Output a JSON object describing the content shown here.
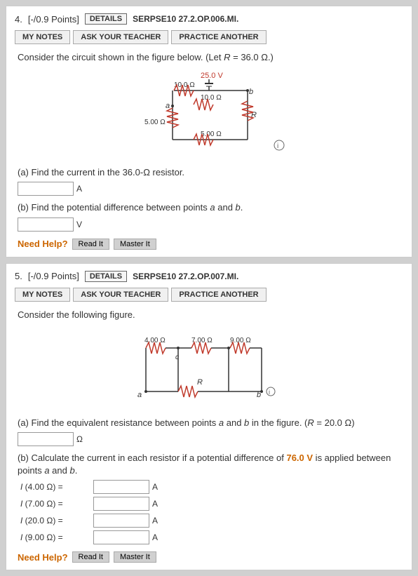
{
  "problems": [
    {
      "number": "4.",
      "points": "[-/0.9 Points]",
      "badge_label": "DETAILS",
      "code": "SERPSE10 27.2.OP.006.MI.",
      "buttons": [
        "MY NOTES",
        "ASK YOUR TEACHER",
        "PRACTICE ANOTHER"
      ],
      "intro": "Consider the circuit shown in the figure below. (Let R = 36.0 Ω.)",
      "sub_a_label": "(a) Find the current in the 36.0-Ω resistor.",
      "sub_a_unit": "A",
      "sub_b_label": "(b) Find the potential difference between points a and b.",
      "sub_b_unit": "V",
      "need_help": "Need Help?",
      "help_btns": [
        "Read It",
        "Master It"
      ]
    },
    {
      "number": "5.",
      "points": "[-/0.9 Points]",
      "badge_label": "DETAILS",
      "code": "SERPSE10 27.2.OP.007.MI.",
      "buttons": [
        "MY NOTES",
        "ASK YOUR TEACHER",
        "PRACTICE ANOTHER"
      ],
      "intro": "Consider the following figure.",
      "sub_a_label": "(a) Find the equivalent resistance between points a and b in the figure.",
      "sub_a_unit": "Ω",
      "sub_a_note": "(R = 20.0 Ω)",
      "sub_b_label": "(b) Calculate the current in each resistor if a potential difference of",
      "sub_b_highlight": "76.0 V",
      "sub_b_suffix": "is applied between points a and b.",
      "sub_parts": [
        {
          "label": "I (4.00 Ω)  =",
          "unit": "A"
        },
        {
          "label": "I (7.00 Ω)  =",
          "unit": "A"
        },
        {
          "label": "I (20.0 Ω)  =",
          "unit": "A"
        },
        {
          "label": "I (9.00 Ω)  =",
          "unit": "A"
        }
      ],
      "need_help": "Need Help?",
      "help_btns": [
        "Read It",
        "Master It"
      ]
    }
  ],
  "notes_label": "NoTeS",
  "my_notes_label": "My Notes"
}
